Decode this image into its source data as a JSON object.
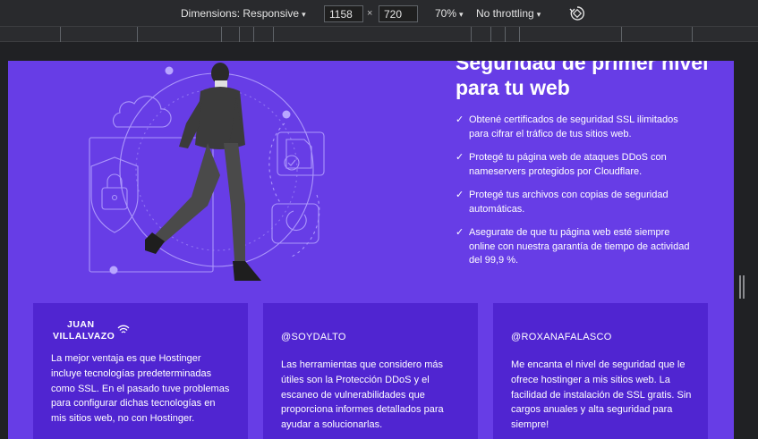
{
  "devtools": {
    "dimensions_label": "Dimensions: Responsive",
    "width": "1158",
    "height": "720",
    "times": "×",
    "zoom": "70%",
    "throttling": "No throttling",
    "caret": "▾"
  },
  "hero": {
    "title": "Seguridad de primer nivel para tu web",
    "check": "✓",
    "features": [
      "Obtené certificados de seguridad SSL ilimitados para cifrar el tráfico de tus sitios web.",
      "Protegé tu página web de ataques DDoS con nameservers protegidos por Cloudflare.",
      "Protegé tus archivos con copias de seguridad automáticas.",
      "Asegurate de que tu página web esté siempre online con nuestra garantía de tiempo de actividad del 99,9 %."
    ]
  },
  "testimonials": [
    {
      "logo_line1": "JUAN",
      "logo_line2": "VILLALVAZO",
      "text": "La mejor ventaja es que Hostinger incluye tecnologías predeterminadas como SSL. En el pasado tuve problemas para configurar dichas tecnologías en mis sitios web, no con Hostinger."
    },
    {
      "handle": "@SOYDALTO",
      "text": "Las herramientas que considero más útiles son la Protección DDoS y el escaneo de vulnerabilidades que proporciona informes detallados para ayudar a solucionarlas."
    },
    {
      "handle": "@ROXANAFALASCO",
      "text": "Me encanta el nivel de seguridad que le ofrece hostinger a mis sitios web. La facilidad de instalación de SSL gratis. Sin cargos anuales y alta seguridad para siempre!"
    }
  ],
  "colors": {
    "page_background": "#673de6",
    "card_background": "#5025d1",
    "devtools_bar": "#292a2d"
  }
}
